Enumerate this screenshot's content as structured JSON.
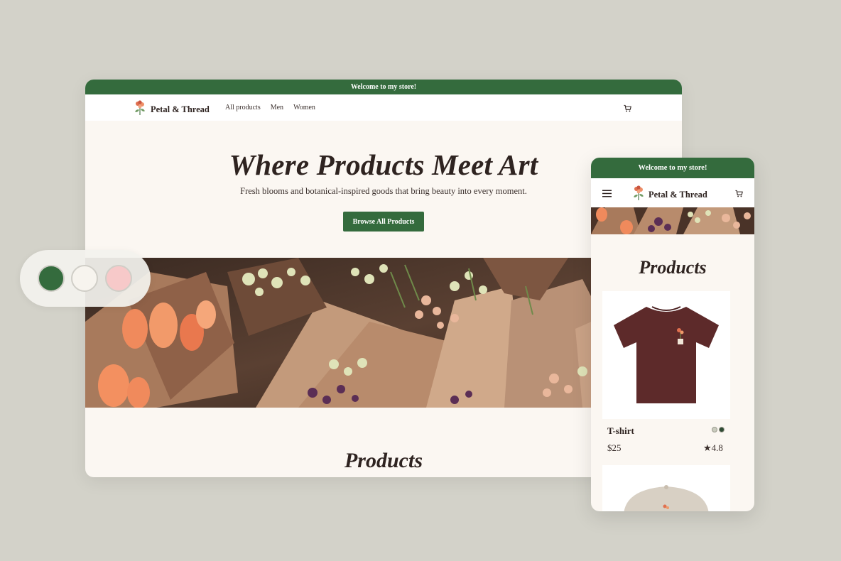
{
  "colors": {
    "brand_green": "#346b3d",
    "cream": "#fbf7f2",
    "text_dark": "#2e2320",
    "tshirt": "#5d2a2a"
  },
  "desktop": {
    "announcement": "Welcome to my store!",
    "store_name": "Petal & Thread",
    "nav_links": [
      "All products",
      "Men",
      "Women"
    ],
    "hero": {
      "title": "Where Products Meet Art",
      "subtitle": "Fresh blooms and botanical-inspired goods that bring beauty into every moment.",
      "button_label": "Browse All Products"
    },
    "products_heading": "Products"
  },
  "theme_swatches": [
    "#346b3d",
    "#f7f4ee",
    "#f7c9c9"
  ],
  "mobile": {
    "announcement": "Welcome to my store!",
    "store_name": "Petal & Thread",
    "products_heading": "Products",
    "product": {
      "name": "T-shirt",
      "price": "$25",
      "rating": "★4.8",
      "color_options": [
        "#c9cbbd",
        "#2e4a33"
      ]
    }
  },
  "icons": [
    "flower-logo-icon",
    "cart-icon",
    "hamburger-menu-icon"
  ]
}
